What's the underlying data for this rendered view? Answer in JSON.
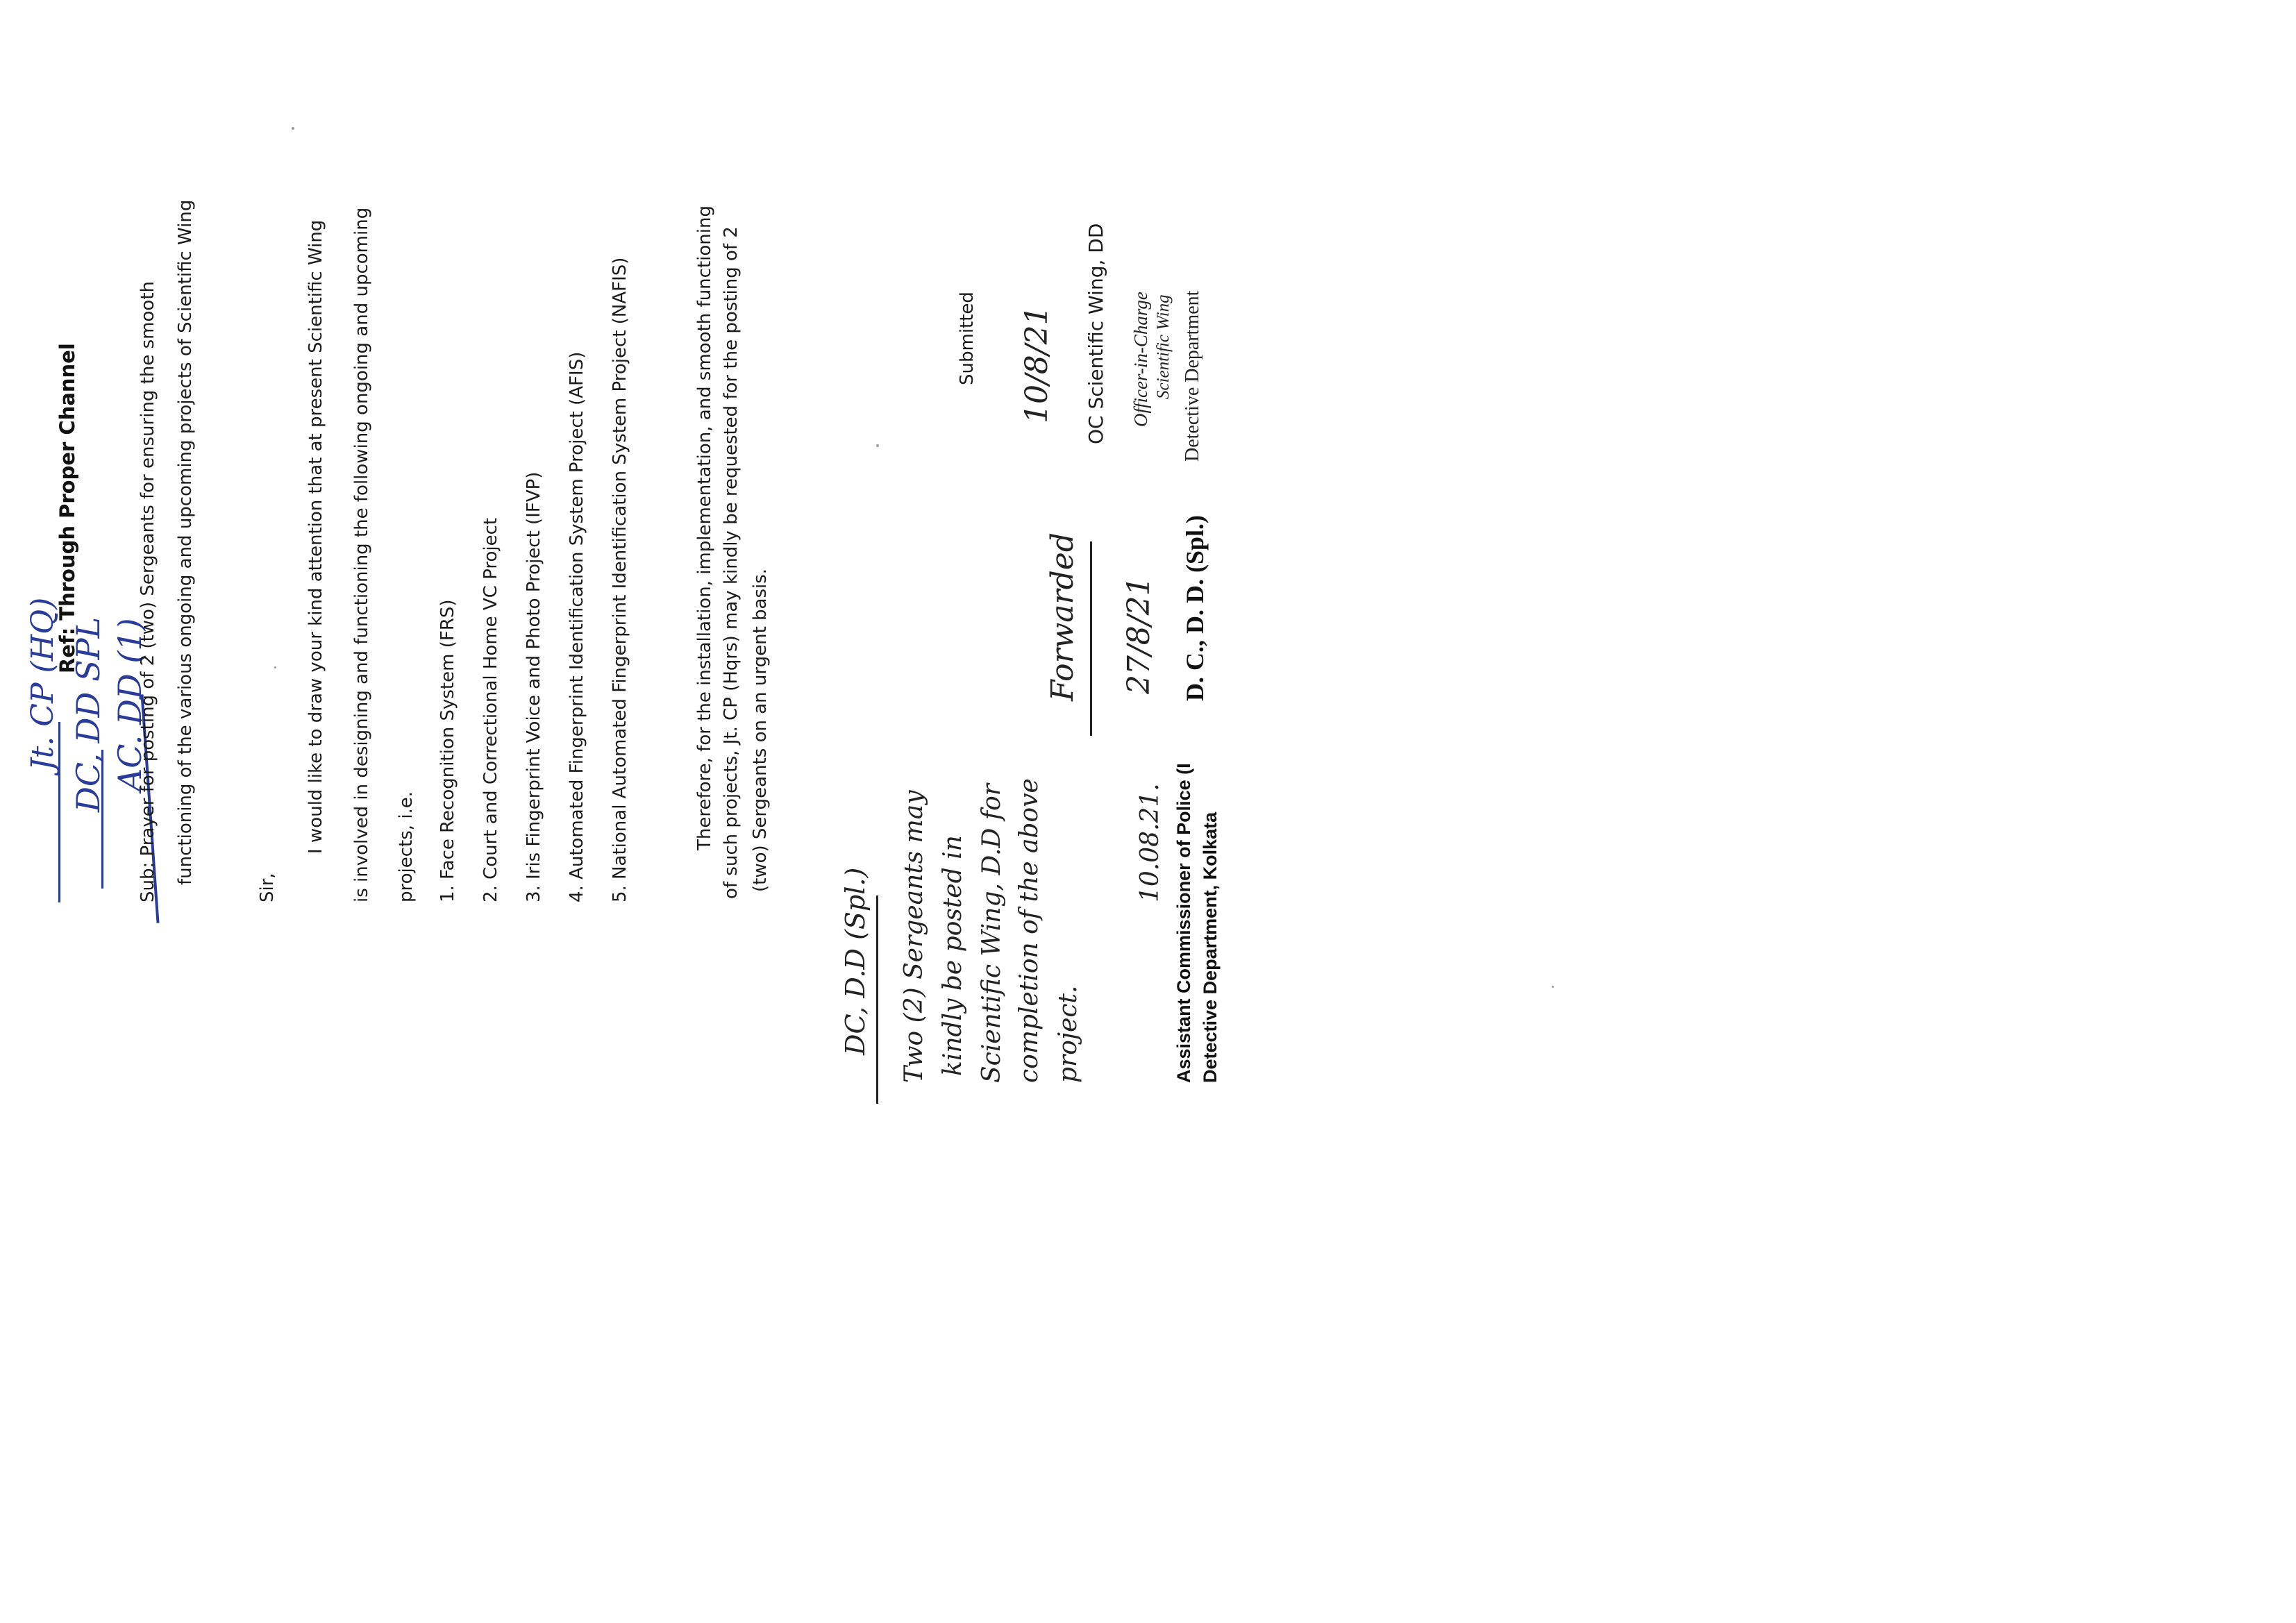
{
  "document": {
    "ref_heading": "Ref: Through Proper Channel",
    "subject_line_1": "Sub: Prayer for posting of 2 (two) Sergeants for ensuring the smooth",
    "subject_line_2": "functioning of the various ongoing and upcoming projects of Scientific Wing",
    "salutation": "Sir,",
    "para1_line1": "I would like to draw your kind attention that at present Scientific Wing",
    "para1_line2": "is involved in designing and functioning the following ongoing and upcoming",
    "para1_line3": "projects, i.e.",
    "projects": [
      "1. Face Recognition System (FRS)",
      "2. Court and Correctional Home VC Project",
      "3. Iris Fingerprint Voice and Photo Project (IFVP)",
      "4. Automated Fingerprint Identification System Project (AFIS)",
      "5. National Automated Fingerprint Identification System Project (NAFIS)"
    ],
    "para2_line1": "Therefore, for the installation, implementation, and smooth functioning",
    "para2_line2": "of such projects, Jt. CP (Hqrs) may kindly be requested for the posting of 2",
    "para2_line3": "(two) Sergeants on an urgent basis.",
    "closing": "Submitted",
    "sign_block_title": "OC Scientific Wing, DD"
  },
  "handwritten_blue": {
    "line1": "Jt. CP (HQ)",
    "line2": "DC, DD SPL",
    "line3": "AC. DD (1)"
  },
  "handwritten_black": {
    "dc_note": "DC, D.D (Spl.)",
    "note_line1": "Two (2) Sergeants may",
    "note_line2": "kindly be posted in",
    "note_line3": "Scientific Wing, D.D for",
    "note_line4": "completion of the above",
    "note_line5": "project.",
    "date_note": "10.08.21.",
    "forwarded": "Forwarded",
    "forwarded_date": "27/8/21",
    "oc_sign_date": "10/8/21"
  },
  "stamps": {
    "ac_line1": "Assistant Commissioner of Police (I",
    "ac_line2": "Detective Department, Kolkata",
    "dc_stamp": "D. C., D. D. (Spl.)",
    "oc_line1": "Officer-in-Charge",
    "oc_line2": "Scientific Wing",
    "oc_line3": "Detective Department"
  }
}
